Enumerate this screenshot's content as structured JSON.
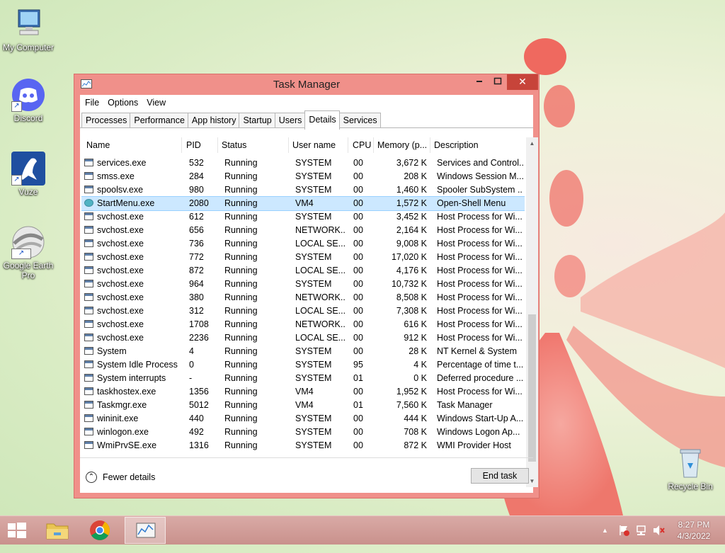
{
  "desktop": {
    "icons": [
      {
        "label": "My Computer"
      },
      {
        "label": "Discord"
      },
      {
        "label": "Vuze"
      },
      {
        "label": "Google Earth Pro"
      },
      {
        "label": "Recycle Bin"
      }
    ]
  },
  "window": {
    "title": "Task Manager",
    "minimize_icon": "minimize-icon",
    "maximize_icon": "maximize-icon",
    "close_glyph": "✕"
  },
  "menu": [
    "File",
    "Options",
    "View"
  ],
  "tabs": [
    "Processes",
    "Performance",
    "App history",
    "Startup",
    "Users",
    "Details",
    "Services"
  ],
  "active_tab": "Details",
  "columns": {
    "name": "Name",
    "pid": "PID",
    "status": "Status",
    "user": "User name",
    "cpu": "CPU",
    "memory": "Memory (p...",
    "description": "Description"
  },
  "processes": [
    {
      "name": "services.exe",
      "pid": "532",
      "status": "Running",
      "user": "SYSTEM",
      "cpu": "00",
      "memory": "3,672 K",
      "description": "Services and Control..."
    },
    {
      "name": "smss.exe",
      "pid": "284",
      "status": "Running",
      "user": "SYSTEM",
      "cpu": "00",
      "memory": "208 K",
      "description": "Windows Session M..."
    },
    {
      "name": "spoolsv.exe",
      "pid": "980",
      "status": "Running",
      "user": "SYSTEM",
      "cpu": "00",
      "memory": "1,460 K",
      "description": "Spooler SubSystem ..."
    },
    {
      "name": "StartMenu.exe",
      "pid": "2080",
      "status": "Running",
      "user": "VM4",
      "cpu": "00",
      "memory": "1,572 K",
      "description": "Open-Shell Menu",
      "selected": true
    },
    {
      "name": "svchost.exe",
      "pid": "612",
      "status": "Running",
      "user": "SYSTEM",
      "cpu": "00",
      "memory": "3,452 K",
      "description": "Host Process for Wi..."
    },
    {
      "name": "svchost.exe",
      "pid": "656",
      "status": "Running",
      "user": "NETWORK...",
      "cpu": "00",
      "memory": "2,164 K",
      "description": "Host Process for Wi..."
    },
    {
      "name": "svchost.exe",
      "pid": "736",
      "status": "Running",
      "user": "LOCAL SE...",
      "cpu": "00",
      "memory": "9,008 K",
      "description": "Host Process for Wi..."
    },
    {
      "name": "svchost.exe",
      "pid": "772",
      "status": "Running",
      "user": "SYSTEM",
      "cpu": "00",
      "memory": "17,020 K",
      "description": "Host Process for Wi..."
    },
    {
      "name": "svchost.exe",
      "pid": "872",
      "status": "Running",
      "user": "LOCAL SE...",
      "cpu": "00",
      "memory": "4,176 K",
      "description": "Host Process for Wi..."
    },
    {
      "name": "svchost.exe",
      "pid": "964",
      "status": "Running",
      "user": "SYSTEM",
      "cpu": "00",
      "memory": "10,732 K",
      "description": "Host Process for Wi..."
    },
    {
      "name": "svchost.exe",
      "pid": "380",
      "status": "Running",
      "user": "NETWORK...",
      "cpu": "00",
      "memory": "8,508 K",
      "description": "Host Process for Wi..."
    },
    {
      "name": "svchost.exe",
      "pid": "312",
      "status": "Running",
      "user": "LOCAL SE...",
      "cpu": "00",
      "memory": "7,308 K",
      "description": "Host Process for Wi..."
    },
    {
      "name": "svchost.exe",
      "pid": "1708",
      "status": "Running",
      "user": "NETWORK...",
      "cpu": "00",
      "memory": "616 K",
      "description": "Host Process for Wi..."
    },
    {
      "name": "svchost.exe",
      "pid": "2236",
      "status": "Running",
      "user": "LOCAL SE...",
      "cpu": "00",
      "memory": "912 K",
      "description": "Host Process for Wi..."
    },
    {
      "name": "System",
      "pid": "4",
      "status": "Running",
      "user": "SYSTEM",
      "cpu": "00",
      "memory": "28 K",
      "description": "NT Kernel & System"
    },
    {
      "name": "System Idle Process",
      "pid": "0",
      "status": "Running",
      "user": "SYSTEM",
      "cpu": "95",
      "memory": "4 K",
      "description": "Percentage of time t..."
    },
    {
      "name": "System interrupts",
      "pid": "-",
      "status": "Running",
      "user": "SYSTEM",
      "cpu": "01",
      "memory": "0 K",
      "description": "Deferred procedure ..."
    },
    {
      "name": "taskhostex.exe",
      "pid": "1356",
      "status": "Running",
      "user": "VM4",
      "cpu": "00",
      "memory": "1,952 K",
      "description": "Host Process for Wi..."
    },
    {
      "name": "Taskmgr.exe",
      "pid": "5012",
      "status": "Running",
      "user": "VM4",
      "cpu": "01",
      "memory": "7,560 K",
      "description": "Task Manager"
    },
    {
      "name": "wininit.exe",
      "pid": "440",
      "status": "Running",
      "user": "SYSTEM",
      "cpu": "00",
      "memory": "444 K",
      "description": "Windows Start-Up A..."
    },
    {
      "name": "winlogon.exe",
      "pid": "492",
      "status": "Running",
      "user": "SYSTEM",
      "cpu": "00",
      "memory": "708 K",
      "description": "Windows Logon Ap..."
    },
    {
      "name": "WmiPrvSE.exe",
      "pid": "1316",
      "status": "Running",
      "user": "SYSTEM",
      "cpu": "00",
      "memory": "872 K",
      "description": "WMI Provider Host"
    }
  ],
  "footer": {
    "fewer_details": "Fewer details",
    "end_task": "End task"
  },
  "taskbar": {
    "clock_time": "8:27 PM",
    "clock_date": "4/3/2022"
  },
  "colors": {
    "window_frame": "#f0908a",
    "close_button": "#c7443a",
    "selected_row": "#cce8ff",
    "taskbar": "#c9918c"
  }
}
